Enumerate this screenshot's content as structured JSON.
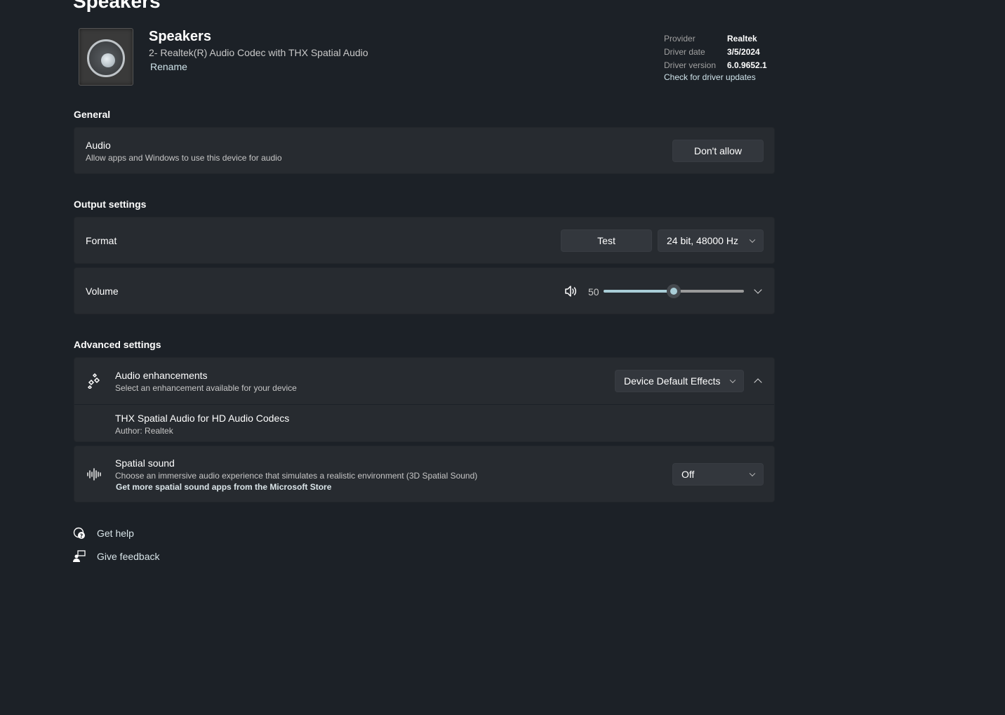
{
  "page_title_partial": "Speakers",
  "device": {
    "name": "Speakers",
    "description": "2- Realtek(R) Audio Codec with THX Spatial Audio",
    "rename_label": "Rename",
    "icon": "speaker-icon"
  },
  "driver": {
    "rows": [
      {
        "key": "Provider",
        "value": "Realtek"
      },
      {
        "key": "Driver date",
        "value": "3/5/2024"
      },
      {
        "key": "Driver version",
        "value": "6.0.9652.1"
      }
    ],
    "update_link": "Check for driver updates"
  },
  "general": {
    "title": "General",
    "audio": {
      "title": "Audio",
      "subtitle": "Allow apps and Windows to use this device for audio",
      "button": "Don't allow"
    }
  },
  "output": {
    "title": "Output settings",
    "format": {
      "title": "Format",
      "test_button": "Test",
      "selected": "24 bit, 48000 Hz"
    },
    "volume": {
      "title": "Volume",
      "value": 50,
      "value_label": "50",
      "max": 100,
      "icon": "speaker-volume-icon"
    }
  },
  "advanced": {
    "title": "Advanced settings",
    "enhancements": {
      "title": "Audio enhancements",
      "subtitle": "Select an enhancement available for your device",
      "selected": "Device Default Effects",
      "expanded": true,
      "item_title": "THX Spatial Audio for HD Audio Codecs",
      "item_author": "Author: Realtek"
    },
    "spatial": {
      "title": "Spatial sound",
      "subtitle": "Choose an immersive audio experience that simulates a realistic environment (3D Spatial Sound)",
      "store_link": "Get more spatial sound apps from the Microsoft Store",
      "selected": "Off"
    }
  },
  "footer": {
    "help": "Get help",
    "feedback": "Give feedback"
  },
  "colors": {
    "background": "#1c2127",
    "card": "#272b30",
    "button": "#33373d",
    "accent": "#a9cdd7"
  }
}
